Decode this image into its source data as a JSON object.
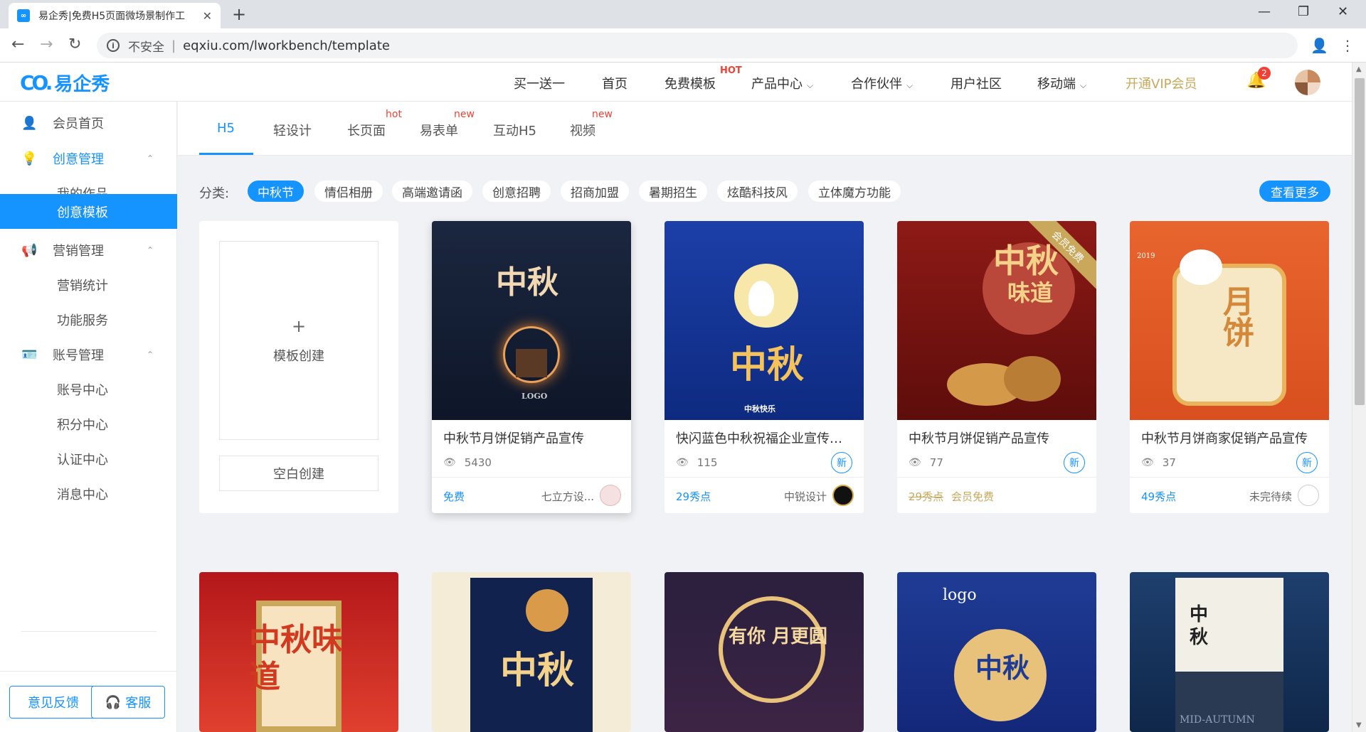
{
  "browser": {
    "tab_title": "易企秀|免费H5页面微场景制作工",
    "favicon": "eqxiu-favicon",
    "insecure_label": "不安全",
    "url": "eqxiu.com/lworkbench/template"
  },
  "header": {
    "logo_mark": "CO.",
    "logo_text": "易企秀",
    "nav": [
      "买一送一",
      "首页",
      "免费模板",
      "产品中心",
      "合作伙伴",
      "用户社区",
      "移动端",
      "开通VIP会员"
    ],
    "hot_badge": "HOT",
    "notification_count": "2"
  },
  "sidebar": {
    "items": [
      "会员首页",
      "创意管理",
      "我的作品",
      "创意模板",
      "营销管理",
      "营销统计",
      "功能服务",
      "账号管理",
      "账号中心",
      "积分中心",
      "认证中心",
      "消息中心"
    ],
    "feedback_button": "意见反馈",
    "service_button": "客服"
  },
  "subtabs": {
    "items": [
      "H5",
      "轻设计",
      "长页面",
      "易表单",
      "互动H5",
      "视频"
    ],
    "badges": {
      "long": "hot",
      "form": "new",
      "video": "new"
    }
  },
  "categories": {
    "label": "分类:",
    "chips": [
      "中秋节",
      "情侣相册",
      "高端邀请函",
      "创意招聘",
      "招商加盟",
      "暑期招生",
      "炫酷科技风",
      "立体魔方功能"
    ],
    "more_button": "查看更多"
  },
  "create_card": {
    "plus": "+",
    "label": "模板创建",
    "blank_button": "空白创建"
  },
  "templates": [
    {
      "title": "中秋节月饼促销产品宣传",
      "views": "5430",
      "price": "免费",
      "author": "七立方设...",
      "thumb_text": "中秋",
      "thumb_sub": "LOGO"
    },
    {
      "title": "快闪蓝色中秋祝福企业宣传大...",
      "views": "115",
      "price": "29秀点",
      "author": "中锐设计",
      "new": "新",
      "thumb_text": "中秋",
      "thumb_sub": "中秋快乐"
    },
    {
      "title": "中秋节月饼促销产品宣传",
      "views": "77",
      "price": "29秀点",
      "vip": "会员免费",
      "ribbon": "会员免费",
      "new": "新",
      "thumb_text": "中秋",
      "thumb_sub": "味道"
    },
    {
      "title": "中秋节月饼商家促销产品宣传",
      "views": "37",
      "price": "49秀点",
      "author": "未完待续",
      "new": "新",
      "thumb_text": "月饼",
      "thumb_sub": "2019"
    }
  ],
  "row2_thumbs": [
    {
      "text": "中秋味道"
    },
    {
      "text": "中秋"
    },
    {
      "text": "有你 月更圆"
    },
    {
      "text": "中秋",
      "sub": "logo"
    },
    {
      "text": "中秋",
      "sub": "MID-AUTUMN"
    }
  ],
  "colors": {
    "accent": "#1593ff",
    "gold": "#c9a85c",
    "badge_red": "#f04134"
  }
}
